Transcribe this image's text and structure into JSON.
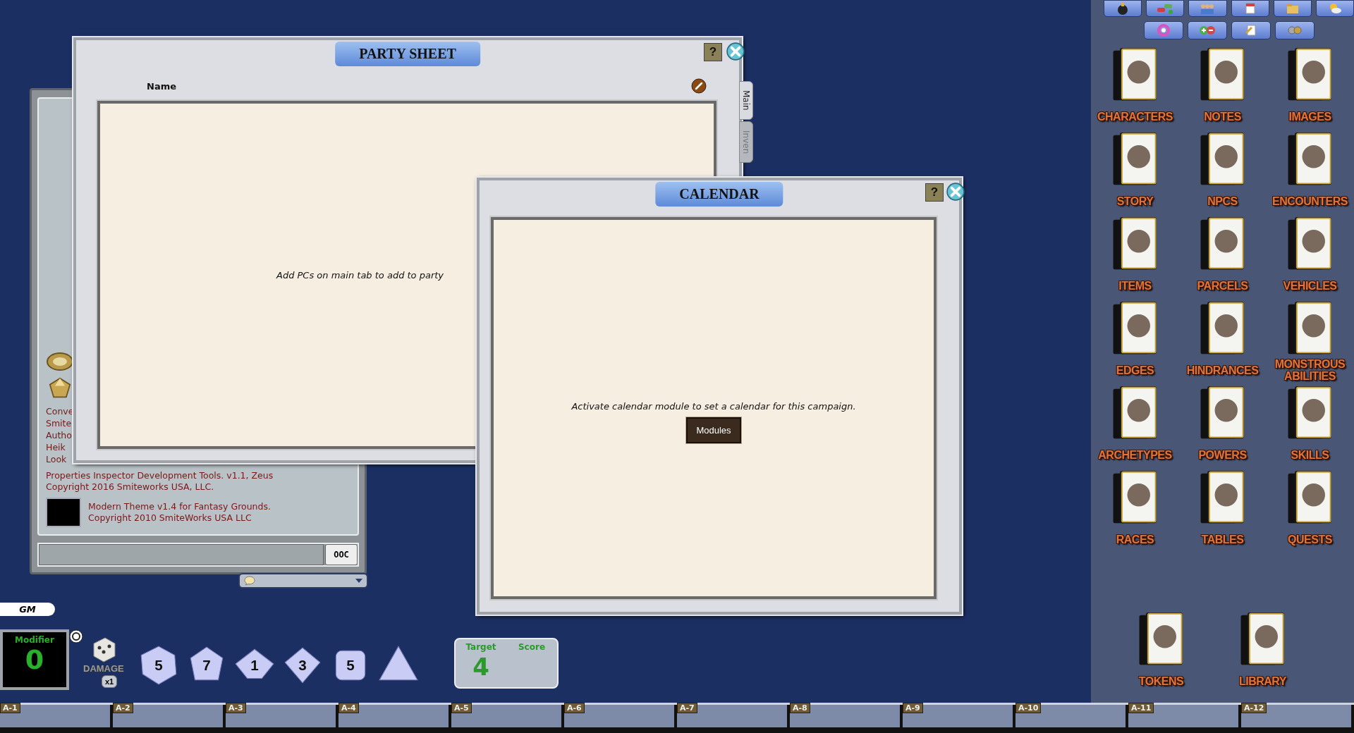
{
  "toolbar": {
    "rows": [
      [
        {
          "kind": "dice-bag"
        },
        {
          "kind": "vehicles"
        },
        {
          "kind": "people"
        },
        {
          "kind": "calendar"
        },
        {
          "kind": "folder"
        },
        {
          "kind": "weather"
        }
      ],
      [
        {
          "kind": "colors"
        },
        {
          "kind": "plus-minus"
        },
        {
          "kind": "note"
        },
        {
          "kind": "gears"
        }
      ]
    ]
  },
  "cards": [
    {
      "label": "CHARACTERS"
    },
    {
      "label": "NOTES"
    },
    {
      "label": "IMAGES"
    },
    {
      "label": "STORY"
    },
    {
      "label": "NPCS"
    },
    {
      "label": "ENCOUNTERS"
    },
    {
      "label": "ITEMS"
    },
    {
      "label": "PARCELS"
    },
    {
      "label": "VEHICLES"
    },
    {
      "label": "EDGES"
    },
    {
      "label": "HINDRANCES"
    },
    {
      "label": "MONSTROUS ABILITIES"
    },
    {
      "label": "ARCHETYPES"
    },
    {
      "label": "POWERS"
    },
    {
      "label": "SKILLS"
    },
    {
      "label": "RACES"
    },
    {
      "label": "TABLES"
    },
    {
      "label": "QUESTS"
    }
  ],
  "bottom_cards": [
    {
      "label": "TOKENS"
    },
    {
      "label": "LIBRARY"
    }
  ],
  "chat": {
    "cut_lines": [
      "Conve",
      "Smite",
      "Autho",
      "Heik",
      "Look"
    ],
    "messages": [
      {
        "has_thumbnail": false,
        "lines": [
          "Properties Inspector Development Tools. v1.1, Zeus",
          "Copyright 2016 Smiteworks USA, LLC."
        ]
      },
      {
        "has_thumbnail": true,
        "lines": [
          "Modern Theme v1.4 for Fantasy Grounds.",
          "Copyright 2010 SmiteWorks USA LLC"
        ]
      }
    ],
    "mode_button": "OOC"
  },
  "party_sheet": {
    "title": "PARTY SHEET",
    "column": "Name",
    "empty_text": "Add PCs on main tab to add to party",
    "help": "?",
    "tabs": [
      {
        "label": "Main",
        "selected": true
      },
      {
        "label": "Inven",
        "selected": false
      }
    ]
  },
  "calendar": {
    "title": "CALENDAR",
    "help": "?",
    "message": "Activate calendar module to set a calendar for this campaign.",
    "button": "Modules"
  },
  "identity": "GM",
  "modifier": {
    "label": "Modifier",
    "value": "0"
  },
  "damage_label": "DAMAGE",
  "multiplier": "x1",
  "dice": [
    {
      "kind": "d20",
      "face": "5"
    },
    {
      "kind": "d12",
      "face": "7"
    },
    {
      "kind": "d10",
      "face": "1"
    },
    {
      "kind": "d8",
      "face": "3"
    },
    {
      "kind": "d6",
      "face": "5"
    },
    {
      "kind": "d4"
    }
  ],
  "target": {
    "label": "Target",
    "value": "4"
  },
  "score": {
    "label": "Score"
  },
  "hotkeys": [
    "A-1",
    "A-2",
    "A-3",
    "A-4",
    "A-5",
    "A-6",
    "A-7",
    "A-8",
    "A-9",
    "A-10",
    "A-11",
    "A-12"
  ]
}
